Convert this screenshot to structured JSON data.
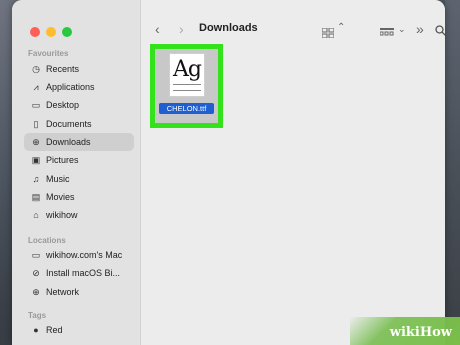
{
  "toolbar": {
    "title": "Downloads",
    "back_icon": "chevron-left-icon",
    "forward_icon": "chevron-right-icon"
  },
  "sidebar": {
    "favourites_label": "Favourites",
    "locations_label": "Locations",
    "tags_label": "Tags",
    "favourites": [
      {
        "label": "Recents",
        "icon": "clock-icon"
      },
      {
        "label": "Applications",
        "icon": "applications-icon"
      },
      {
        "label": "Desktop",
        "icon": "desktop-icon"
      },
      {
        "label": "Documents",
        "icon": "document-icon"
      },
      {
        "label": "Downloads",
        "icon": "download-icon"
      },
      {
        "label": "Pictures",
        "icon": "pictures-icon"
      },
      {
        "label": "Music",
        "icon": "music-icon"
      },
      {
        "label": "Movies",
        "icon": "movies-icon"
      },
      {
        "label": "wikihow",
        "icon": "house-icon"
      }
    ],
    "locations": [
      {
        "label": "wikihow.com's Mac",
        "icon": "computer-icon"
      },
      {
        "label": "Install macOS Bi...",
        "icon": "disk-icon"
      },
      {
        "label": "Network",
        "icon": "globe-icon"
      }
    ],
    "tags": [
      {
        "label": "Red",
        "color": "#222222"
      }
    ]
  },
  "files": [
    {
      "name": "CHELON.ttf",
      "preview_text": "Ag"
    }
  ],
  "watermark": {
    "text": "wikiHow"
  }
}
